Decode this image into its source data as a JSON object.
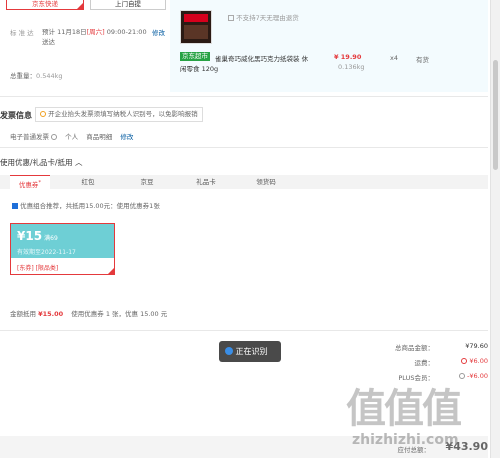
{
  "delivery": {
    "btn_jd": "京东快递",
    "btn_pickup": "上门自提",
    "standard_label": "标 准 达",
    "standard_prefix": "预计 11月18日",
    "weekday": "[周六]",
    "time_window": "09:00-21:00 送达",
    "edit": "修改",
    "weight_label": "总重量：",
    "weight_value": "0.544kg"
  },
  "product": {
    "return_note": "不支持7天无理由退货",
    "badge": "京东超市",
    "name_line1": "雀巢奇巧威化黑巧克力纸袋装 休",
    "name_line2": "闲零食 120g",
    "price": "¥ 19.90",
    "weight": "0.136kg",
    "qty": "x4",
    "stock": "有货"
  },
  "invoice": {
    "title": "发票信息",
    "tip": "开企业抬头发票须填写纳税人识别号，以免影响报销",
    "type": "电子普通发票",
    "holder": "个人",
    "content": "商品明细",
    "edit": "修改"
  },
  "coupons": {
    "section_title": "使用优惠/礼品卡/抵用",
    "tabs": [
      "优惠券",
      "红包",
      "京豆",
      "礼品卡",
      "领货码"
    ],
    "combo_note": "优惠组合推荐，共抵用15.00元：使用优惠券1张",
    "coupon_amount": "¥15",
    "coupon_condition": "满69",
    "coupon_expiry": "有效期至2022-11-17",
    "coupon_tags": "[东券] [限品类]",
    "deduct_label": "金额抵用",
    "deduct_amount": "¥15.00",
    "deduct_detail": "使用优惠券 1 张，优惠 15.00 元"
  },
  "toast": {
    "text": "正在识别"
  },
  "summary": {
    "total_label": "总商品金额：",
    "total_value": "¥79.60",
    "shipping_label": "运费：",
    "shipping_value": "¥6.00",
    "plus_label": "PLUS会员：",
    "plus_value": "-¥6.00",
    "pay_label": "应付总额：",
    "pay_value": "¥43.90"
  },
  "watermark": {
    "big": "值值值",
    "site": "zhizhizhi.com"
  },
  "colors": {
    "accent": "#e4393c",
    "link": "#005aa0",
    "product_bg": "#f3fbfe",
    "coupon_bg": "#6ecfd5",
    "toast_bg": "#4a4a4a"
  },
  "icons": [
    "clock-icon",
    "info-icon",
    "checkbox-icon",
    "chevron-up-icon"
  ]
}
